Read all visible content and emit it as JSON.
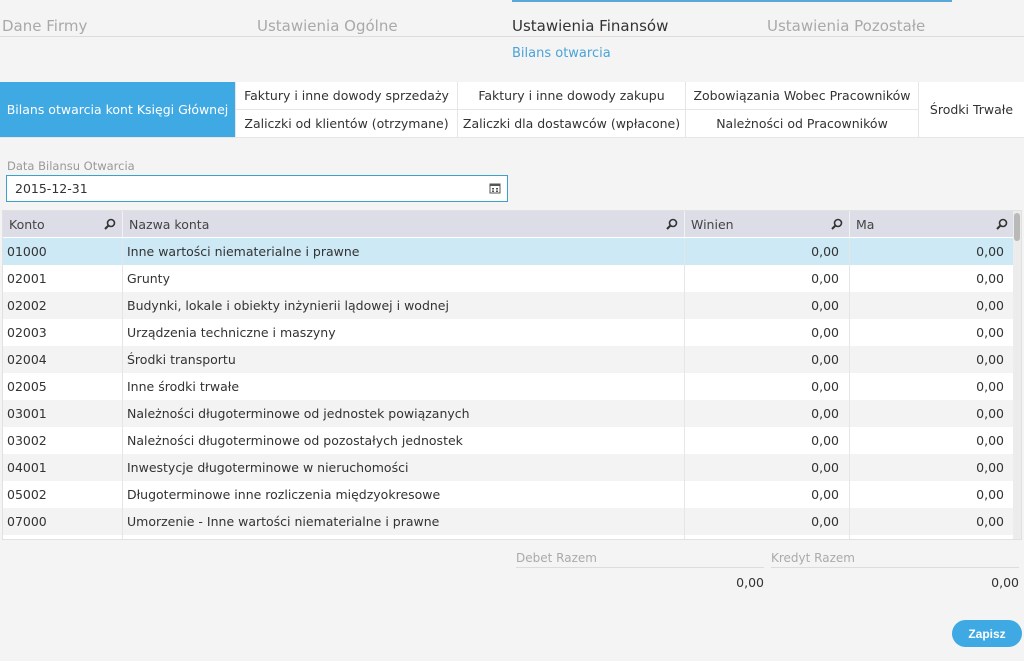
{
  "top_tabs": [
    "Dane Firmy",
    "Ustawienia Ogólne",
    "Ustawienia Finansów",
    "Ustawienia Pozostałe"
  ],
  "subnav": {
    "active_label": "Bilans otwarcia"
  },
  "subtabs": {
    "main": "Bilans otwarcia kont Księgi Głównej",
    "sales_docs": "Faktury i inne dowody sprzedaży",
    "customer_advances": "Zaliczki od klientów (otrzymane)",
    "purchase_docs": "Faktury i inne dowody zakupu",
    "supplier_advances": "Zaliczki dla dostawców (wpłacone)",
    "employee_liabilities": "Zobowiązania Wobec Pracowników",
    "employee_receivables": "Należności od Pracowników",
    "fixed_assets": "Środki Trwałe"
  },
  "date_field": {
    "label": "Data Bilansu Otwarcia",
    "value": "2015-12-31"
  },
  "grid": {
    "columns": [
      "Konto",
      "Nazwa konta",
      "Winien",
      "Ma"
    ],
    "rows": [
      {
        "konto": "01000",
        "nazwa": "Inne wartości niematerialne i prawne",
        "winien": "0,00",
        "ma": "0,00"
      },
      {
        "konto": "02001",
        "nazwa": "Grunty",
        "winien": "0,00",
        "ma": "0,00"
      },
      {
        "konto": "02002",
        "nazwa": "Budynki, lokale i obiekty inżynierii lądowej i wodnej",
        "winien": "0,00",
        "ma": "0,00"
      },
      {
        "konto": "02003",
        "nazwa": "Urządzenia techniczne i maszyny",
        "winien": "0,00",
        "ma": "0,00"
      },
      {
        "konto": "02004",
        "nazwa": "Środki transportu",
        "winien": "0,00",
        "ma": "0,00"
      },
      {
        "konto": "02005",
        "nazwa": "Inne środki trwałe",
        "winien": "0,00",
        "ma": "0,00"
      },
      {
        "konto": "03001",
        "nazwa": "Należności długoterminowe od jednostek powiązanych",
        "winien": "0,00",
        "ma": "0,00"
      },
      {
        "konto": "03002",
        "nazwa": "Należności długoterminowe od pozostałych jednostek",
        "winien": "0,00",
        "ma": "0,00"
      },
      {
        "konto": "04001",
        "nazwa": "Inwestycje długoterminowe w nieruchomości",
        "winien": "0,00",
        "ma": "0,00"
      },
      {
        "konto": "05002",
        "nazwa": "Długoterminowe inne rozliczenia międzyokresowe",
        "winien": "0,00",
        "ma": "0,00"
      },
      {
        "konto": "07000",
        "nazwa": "Umorzenie - Inne wartości niematerialne i prawne",
        "winien": "0,00",
        "ma": "0,00"
      }
    ]
  },
  "totals": {
    "debit_label": "Debet Razem",
    "debit_value": "0,00",
    "credit_label": "Kredyt Razem",
    "credit_value": "0,00"
  },
  "save_label": "Zapisz",
  "colors": {
    "accent": "#3fa9e3",
    "selected_row": "#cde9f6",
    "header_bg": "#dcdde6"
  },
  "icons": {
    "date_field": "calendar-icon",
    "column_filter": "search-icon"
  }
}
